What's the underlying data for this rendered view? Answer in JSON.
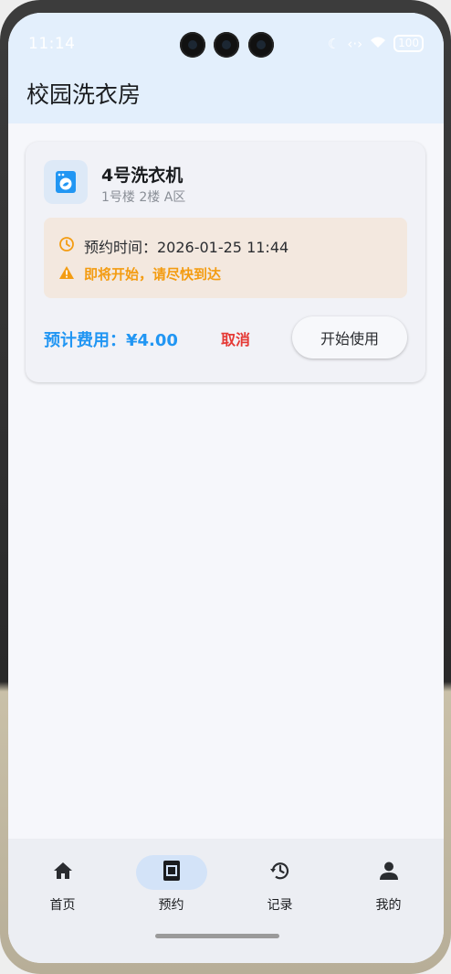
{
  "status": {
    "time": "11:14",
    "battery": "100"
  },
  "app": {
    "title": "校园洗衣房"
  },
  "reservation": {
    "machine_name": "4号洗衣机",
    "location": "1号楼 2楼 A区",
    "time_label": "预约时间：2026-01-25 11:44",
    "warning": "即将开始，请尽快到达",
    "cost": "预计费用：¥4.00",
    "cancel_label": "取消",
    "start_label": "开始使用"
  },
  "nav": {
    "items": [
      {
        "label": "首页",
        "icon": "home-icon"
      },
      {
        "label": "预约",
        "icon": "calendar-icon",
        "active": true
      },
      {
        "label": "记录",
        "icon": "history-icon"
      },
      {
        "label": "我的",
        "icon": "person-icon"
      }
    ]
  },
  "colors": {
    "accent": "#2196f3",
    "danger": "#e53935",
    "warning": "#f39c12",
    "header_bg": "#e3effc"
  }
}
